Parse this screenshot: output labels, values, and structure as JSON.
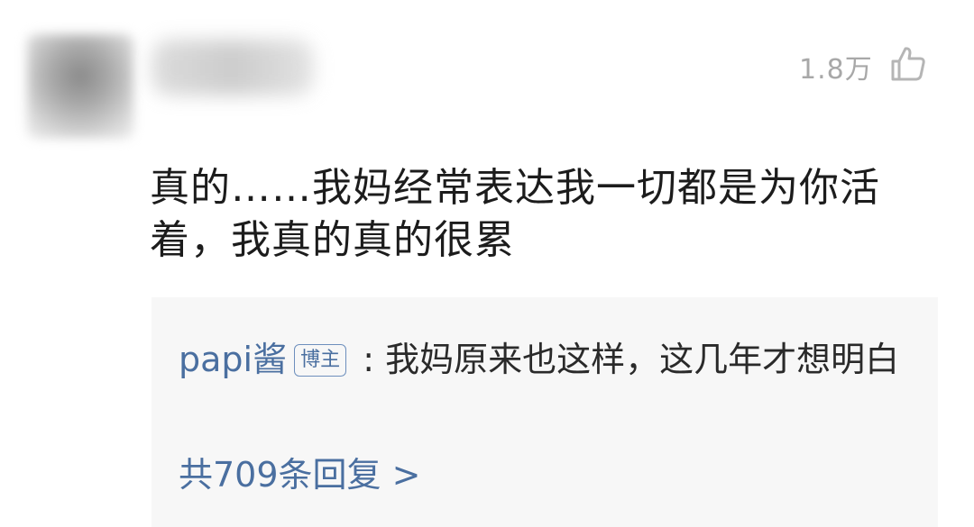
{
  "comment": {
    "like_count": "1.8万",
    "text": "真的……我妈经常表达我一切都是为你活着，我真的真的很累",
    "reply": {
      "author": "papi酱",
      "badge": "博主",
      "separator": " : ",
      "text": "我妈原来也这样，这几年才想明白"
    },
    "more_replies": "共709条回复 >"
  },
  "icons": {
    "like": "thumbs-up-icon"
  },
  "colors": {
    "link_blue": "#4a6fa0",
    "like_gray": "#a8a8a8",
    "reply_bg": "#f7f7f7"
  }
}
